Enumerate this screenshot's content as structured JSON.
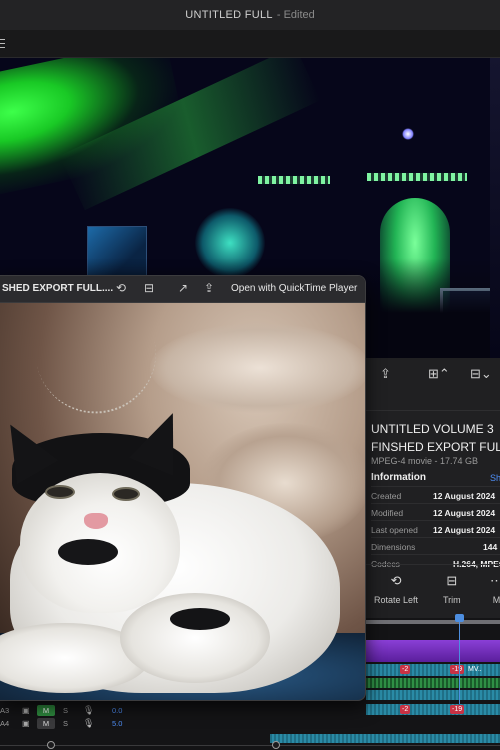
{
  "app": {
    "title": "UNTITLED FULL",
    "edited_suffix": "- Edited"
  },
  "quicklook": {
    "filename": "SHED EXPORT FULL....",
    "open_with": "Open with QuickTime Player"
  },
  "info_panel": {
    "title_line1": "UNTITLED VOLUME 3",
    "title_line2": "FINSHED EXPORT FULL.",
    "subtitle": "MPEG-4 movie - 17.74 GB",
    "section_heading": "Information",
    "show_more": "Sh",
    "rows": [
      {
        "key": "Created",
        "value": "12 August 2024"
      },
      {
        "key": "Modified",
        "value": "12 August 2024"
      },
      {
        "key": "Last opened",
        "value": "12 August 2024"
      },
      {
        "key": "Dimensions",
        "value": "144"
      },
      {
        "key": "Codecs",
        "value": "H.264, MPEG"
      }
    ],
    "actions": [
      {
        "label": "Rotate Left",
        "icon": "rotate-left-icon",
        "glyph": "⟲"
      },
      {
        "label": "Trim",
        "icon": "trim-icon",
        "glyph": "⊟"
      },
      {
        "label": "M",
        "icon": "more-icon",
        "glyph": "⋯"
      }
    ]
  },
  "timeline": {
    "clip_labels": [
      "MV..",
      "MV"
    ],
    "fx_labels": [
      "-2",
      "-19",
      "-2",
      "-19"
    ],
    "tracks": [
      {
        "label": "A3",
        "mute": "M",
        "solo": "S",
        "volume": "0.0",
        "muted_active": true
      },
      {
        "label": "A4",
        "mute": "M",
        "solo": "S",
        "volume": "5.0",
        "muted_active": false
      }
    ]
  },
  "colors": {
    "accent_blue": "#4f8ff7",
    "clip_purple": "#8a3fd6",
    "clip_teal": "#2a8ba6",
    "fx_red": "#c83244",
    "mute_green": "#2e8a3e"
  }
}
